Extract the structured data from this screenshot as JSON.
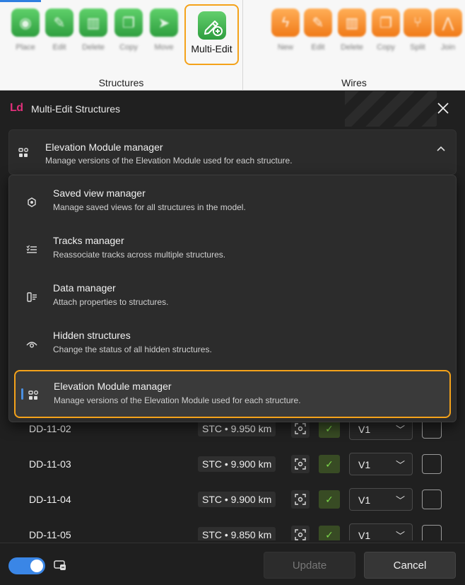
{
  "ribbon": {
    "structures": {
      "label": "Structures",
      "buttons": [
        {
          "label": "Place",
          "icon": "place-icon"
        },
        {
          "label": "Edit",
          "icon": "edit-icon"
        },
        {
          "label": "Delete",
          "icon": "delete-icon"
        },
        {
          "label": "Copy",
          "icon": "copy-icon"
        },
        {
          "label": "Move",
          "icon": "move-icon"
        }
      ],
      "multi_edit": {
        "label": "Multi-Edit",
        "icon": "multi-edit-icon"
      }
    },
    "wires": {
      "label": "Wires",
      "buttons": [
        {
          "label": "New",
          "icon": "new-wire-icon"
        },
        {
          "label": "Edit",
          "icon": "edit-icon"
        },
        {
          "label": "Delete",
          "icon": "delete-icon"
        },
        {
          "label": "Copy",
          "icon": "copy-icon"
        },
        {
          "label": "Split",
          "icon": "split-icon"
        },
        {
          "label": "Join",
          "icon": "join-icon"
        }
      ]
    },
    "colors": {
      "structures": "#3fb34f",
      "wires": "#f58a26",
      "highlight": "#f4a21a"
    }
  },
  "window": {
    "logo": "Ld",
    "title": "Multi-Edit Structures",
    "close_icon": "close-icon"
  },
  "selector": {
    "title": "Elevation Module manager",
    "subtitle": "Manage versions of the Elevation Module used for each structure."
  },
  "dropdown": {
    "options": [
      {
        "title": "Saved view manager",
        "subtitle": "Manage saved views for all structures in the model.",
        "icon": "saved-view-icon"
      },
      {
        "title": "Tracks manager",
        "subtitle": "Reassociate tracks across multiple structures.",
        "icon": "tracks-icon"
      },
      {
        "title": "Data manager",
        "subtitle": "Attach properties to structures.",
        "icon": "data-icon"
      },
      {
        "title": "Hidden structures",
        "subtitle": "Change the status of all hidden structures.",
        "icon": "eye-icon"
      },
      {
        "title": "Elevation Module manager",
        "subtitle": "Manage versions of the Elevation Module used for each structure.",
        "icon": "elevation-module-icon",
        "selected": true
      }
    ]
  },
  "table": {
    "rows": [
      {
        "name": "DD-11-02",
        "station": "STC • 9.950 km",
        "version": "V1"
      },
      {
        "name": "DD-11-03",
        "station": "STC • 9.900 km",
        "version": "V1"
      },
      {
        "name": "DD-11-04",
        "station": "STC • 9.900 km",
        "version": "V1"
      },
      {
        "name": "DD-11-05",
        "station": "STC • 9.850 km",
        "version": "V1"
      }
    ]
  },
  "footer": {
    "update_label": "Update",
    "cancel_label": "Cancel",
    "toggle_on": true
  }
}
